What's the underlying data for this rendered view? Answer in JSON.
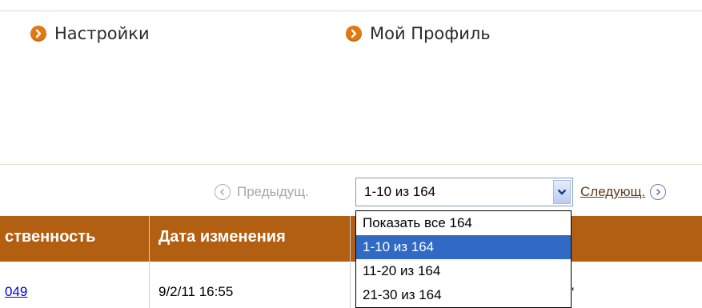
{
  "quick_links": {
    "settings": "Настройки",
    "profile": "Мой Профиль"
  },
  "pager": {
    "prev_label": "Предыдущ.",
    "next_label": "Следующ.",
    "selected_range": "1-10 из 164",
    "options": [
      "Показать все 164",
      "1-10 из 164",
      "11-20 из 164",
      "21-30 из 164"
    ],
    "selected_index": 1
  },
  "table": {
    "headers": {
      "responsibility": "ственность",
      "modified_date": "Дата изменения"
    },
    "rows": [
      {
        "id_link": "049",
        "modified_date": "9/2/11 16:55",
        "trailing": "'"
      }
    ]
  },
  "colors": {
    "accent_orange": "#e07a10",
    "header_brown": "#b35f12",
    "selection_blue": "#316ac5",
    "link_blue": "#0000cc"
  },
  "icons": {
    "settings": "arrow-right-circle-icon",
    "profile": "arrow-right-circle-icon",
    "prev": "arrow-left-circle-icon",
    "next": "arrow-right-circle-icon",
    "dropdown": "chevron-down-icon"
  }
}
